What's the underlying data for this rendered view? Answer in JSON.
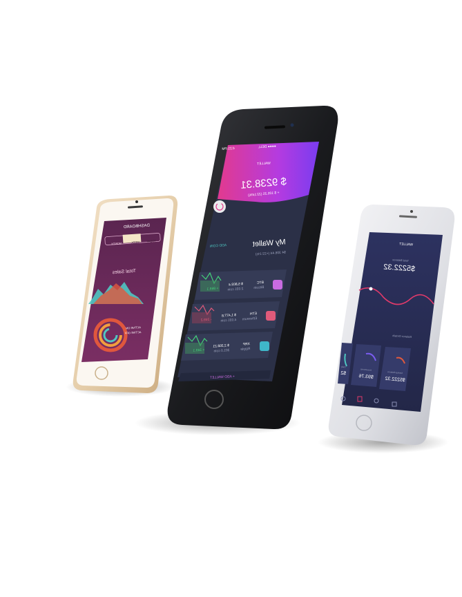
{
  "left_phone": {
    "title": "DASHBOARD",
    "tabs": [
      "TODAY",
      "WEEK",
      "MONTH"
    ],
    "active_tab": "WEEK",
    "section": "Total Sales",
    "legend": [
      "ACTIVE ON",
      "ACTIVE OFF"
    ],
    "colors": {
      "bg": "#6b2a5a",
      "accent": "#f29f3d",
      "teal": "#4fc7c2"
    }
  },
  "center_phone": {
    "status_carrier": "●●●● DELL",
    "status_time": "4:21 PM",
    "status_battery": "100%",
    "header_title": "WALLET",
    "balance": "$ 9238.31",
    "balance_change": "+ $ 105.25 (22.14%)",
    "wallet_title": "My Wallet",
    "wallet_sub": "$4 306.44 (+22.1%)",
    "add_coin": "ADD COIN",
    "coins": [
      {
        "symbol": "BTC",
        "name": "Bitcoin",
        "value": "$ 5,803.4",
        "amount": "2.031 coin",
        "change": "+ 869.1"
      },
      {
        "symbol": "ETH",
        "name": "Ethereum",
        "value": "$ 1,477.8",
        "amount": "4.031 coin",
        "change": "- 249.2"
      },
      {
        "symbol": "XRP",
        "name": "Ripple",
        "value": "$ 2,358.21",
        "amount": "301.0 coin",
        "change": "+ 349.1"
      }
    ],
    "add_wallet": "+ ADD WALLET",
    "colors": {
      "bg": "#2b3047",
      "pink": "#e23a8e",
      "violet": "#7a3cf0"
    }
  },
  "right_phone": {
    "header_title": "WALLET",
    "balance_label": "Total Balance",
    "balance": "$5222.32",
    "section": "Balance Details",
    "cards": [
      {
        "label": "Savings Balance",
        "value": "$5222.32"
      },
      {
        "label": "Investments",
        "value": "$93.76"
      },
      {
        "label": "Daily",
        "value": "$2"
      }
    ],
    "nav_icons": [
      "wallet-icon",
      "coins-icon",
      "search-icon",
      "settings-icon"
    ],
    "colors": {
      "bg": "#2a2f5c",
      "line": "#e03a6a"
    }
  }
}
